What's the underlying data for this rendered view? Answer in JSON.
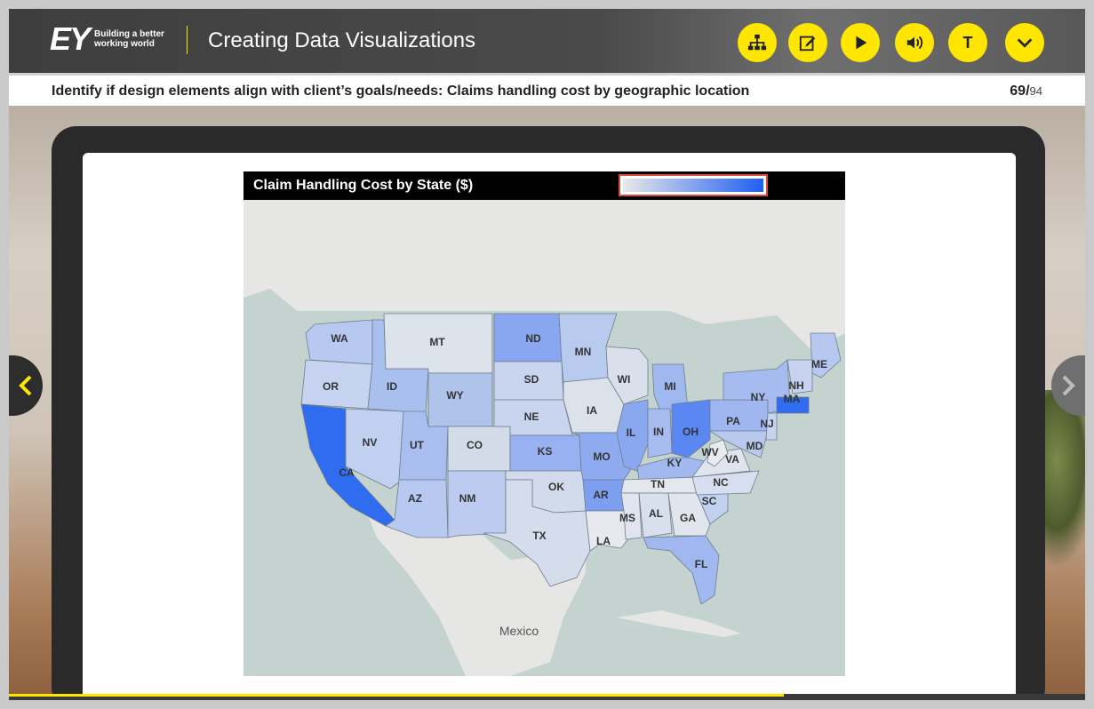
{
  "brand": {
    "logo": "EY",
    "tagline": "Building a better working world"
  },
  "course": {
    "title": "Creating Data Visualizations"
  },
  "toolbar": {
    "buttons": [
      {
        "name": "menu-button",
        "icon": "sitemap-icon"
      },
      {
        "name": "notes-button",
        "icon": "edit-icon"
      },
      {
        "name": "play-button",
        "icon": "play-icon"
      },
      {
        "name": "audio-button",
        "icon": "speaker-icon"
      },
      {
        "name": "transcript-button",
        "icon": "text-icon",
        "label": "T"
      },
      {
        "name": "more-button",
        "icon": "chevron-down-icon"
      }
    ],
    "accent": "#ffe600"
  },
  "slide": {
    "question": "Identify if design elements align with client’s goals/needs: Claims handling cost by geographic location",
    "current": "69",
    "separator": "/",
    "total": "94",
    "progress_fraction": 0.72
  },
  "chart_data": {
    "type": "choropleth-map",
    "title": "Claim Handling Cost by State ($)",
    "legend": {
      "kind": "color-gradient",
      "low_color": "#e9e9e9",
      "high_color": "#1f5ff0",
      "placement": "top-right"
    },
    "country_label": "Mexico",
    "states": [
      {
        "code": "WA",
        "shade": "#b7c9f0"
      },
      {
        "code": "OR",
        "shade": "#c6d3f0"
      },
      {
        "code": "CA",
        "shade": "#2f6cf0"
      },
      {
        "code": "NV",
        "shade": "#c1cff1"
      },
      {
        "code": "ID",
        "shade": "#a9bfee"
      },
      {
        "code": "MT",
        "shade": "#dde3ea"
      },
      {
        "code": "WY",
        "shade": "#b0c3eb"
      },
      {
        "code": "UT",
        "shade": "#a9bdee"
      },
      {
        "code": "AZ",
        "shade": "#b7c9f0"
      },
      {
        "code": "CO",
        "shade": "#d3dbe8"
      },
      {
        "code": "NM",
        "shade": "#bccbef"
      },
      {
        "code": "ND",
        "shade": "#89a7f0"
      },
      {
        "code": "SD",
        "shade": "#c9d5ef"
      },
      {
        "code": "NE",
        "shade": "#c9d4ee"
      },
      {
        "code": "KS",
        "shade": "#98b1f0"
      },
      {
        "code": "OK",
        "shade": "#d2dbec"
      },
      {
        "code": "TX",
        "shade": "#d5dcec"
      },
      {
        "code": "MN",
        "shade": "#b9caef"
      },
      {
        "code": "IA",
        "shade": "#dce2ea"
      },
      {
        "code": "MO",
        "shade": "#8eabf0"
      },
      {
        "code": "AR",
        "shade": "#7e9ff0"
      },
      {
        "code": "LA",
        "shade": "#e7e9ee"
      },
      {
        "code": "WI",
        "shade": "#d9e0ec"
      },
      {
        "code": "IL",
        "shade": "#8aa8f0"
      },
      {
        "code": "MI",
        "shade": "#a0b8f0"
      },
      {
        "code": "IN",
        "shade": "#a7bcf0"
      },
      {
        "code": "OH",
        "shade": "#5a87f2"
      },
      {
        "code": "KY",
        "shade": "#a2b9f0"
      },
      {
        "code": "TN",
        "shade": "#e4e7ee"
      },
      {
        "code": "MS",
        "shade": "#dfe4ee"
      },
      {
        "code": "AL",
        "shade": "#d8dfed"
      },
      {
        "code": "GA",
        "shade": "#e1e5ee"
      },
      {
        "code": "FL",
        "shade": "#a0b7f0"
      },
      {
        "code": "SC",
        "shade": "#c2d0f0"
      },
      {
        "code": "NC",
        "shade": "#d6deef"
      },
      {
        "code": "VA",
        "shade": "#dfe4ee"
      },
      {
        "code": "WV",
        "shade": "#e9ebef"
      },
      {
        "code": "PA",
        "shade": "#9fb6f0"
      },
      {
        "code": "NY",
        "shade": "#a6bcf0"
      },
      {
        "code": "MD",
        "shade": "#b9c8ee"
      },
      {
        "code": "NJ",
        "shade": "#c8d3ee"
      },
      {
        "code": "ME",
        "shade": "#b6c8f0"
      },
      {
        "code": "NH",
        "shade": "#c6d2ef"
      },
      {
        "code": "MA",
        "shade": "#2f6cf0"
      }
    ]
  }
}
